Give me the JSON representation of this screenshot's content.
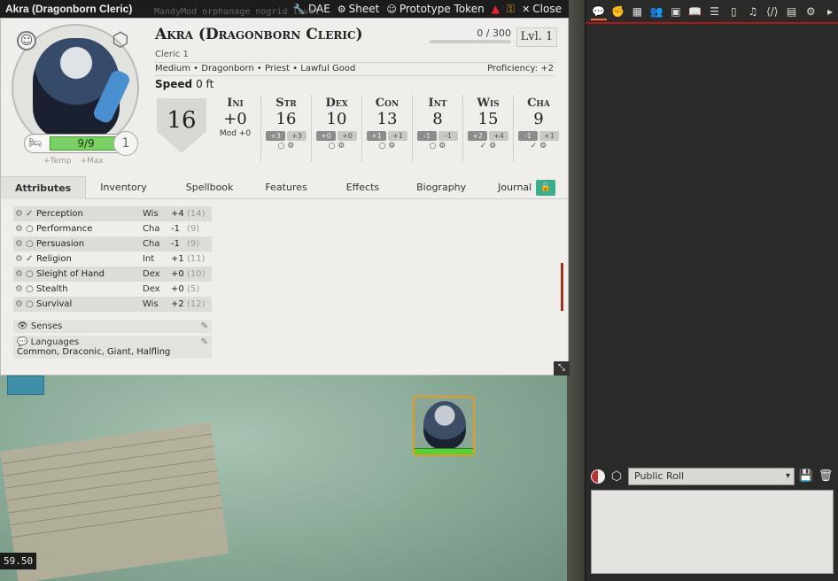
{
  "canvas": {
    "coord_readout": "59.50"
  },
  "header": {
    "title": "Akra (Dragonborn Cleric)",
    "ghost_text": "MandyMod orphanage nogrid level",
    "buttons": [
      {
        "label": "DAE",
        "icon": "wrench-icon",
        "glyph": "🔧"
      },
      {
        "label": "Sheet",
        "icon": "gear-icon",
        "glyph": "⚙"
      },
      {
        "label": "Prototype Token",
        "icon": "user-circle-icon",
        "glyph": "☺"
      },
      {
        "label": "Close",
        "icon": "close-icon",
        "glyph": "✕"
      }
    ]
  },
  "sheet": {
    "name": "Akra (Dragonborn Cleric)",
    "class": "Cleric 1",
    "details": "Medium • Dragonborn • Priest • Lawful Good",
    "proficiency": "Proficiency: +2",
    "speed_label": "Speed",
    "speed_value": "0 ft",
    "xp": "0 / 300",
    "level": "Lvl. 1",
    "hp": "9/9",
    "hp_level": "1",
    "temp_label": "+Temp",
    "max_label": "+Max",
    "ac": "16",
    "initiative": {
      "name": "Ini",
      "score": "+0",
      "mod_label": "Mod",
      "mod": "+0"
    },
    "abilities": [
      {
        "name": "Str",
        "score": "16",
        "save": "+3",
        "mod": "+3",
        "prof": false
      },
      {
        "name": "Dex",
        "score": "10",
        "save": "+0",
        "mod": "+0",
        "prof": false
      },
      {
        "name": "Con",
        "score": "13",
        "save": "+1",
        "mod": "+1",
        "prof": false
      },
      {
        "name": "Int",
        "score": "8",
        "save": "-1",
        "mod": "-1",
        "prof": false
      },
      {
        "name": "Wis",
        "score": "15",
        "save": "+2",
        "mod": "+4",
        "prof": true
      },
      {
        "name": "Cha",
        "score": "9",
        "save": "-1",
        "mod": "+1",
        "prof": true
      }
    ],
    "tabs": [
      "Attributes",
      "Inventory",
      "Spellbook",
      "Features",
      "Effects",
      "Biography",
      "Journal"
    ],
    "skills": [
      {
        "name": "Perception",
        "ability": "Wis",
        "mod": "+4",
        "passive": "(14)",
        "prof": true
      },
      {
        "name": "Performance",
        "ability": "Cha",
        "mod": "-1",
        "passive": "(9)",
        "prof": false
      },
      {
        "name": "Persuasion",
        "ability": "Cha",
        "mod": "-1",
        "passive": "(9)",
        "prof": false
      },
      {
        "name": "Religion",
        "ability": "Int",
        "mod": "+1",
        "passive": "(11)",
        "prof": true
      },
      {
        "name": "Sleight of Hand",
        "ability": "Dex",
        "mod": "+0",
        "passive": "(10)",
        "prof": false
      },
      {
        "name": "Stealth",
        "ability": "Dex",
        "mod": "+0",
        "passive": "(5)",
        "prof": false
      },
      {
        "name": "Survival",
        "ability": "Wis",
        "mod": "+2",
        "passive": "(12)",
        "prof": false
      }
    ],
    "senses_label": "Senses",
    "languages_label": "Languages",
    "languages": "Common, Draconic, Giant, Halfling"
  },
  "sidebar": {
    "tab_icons": [
      "chat-icon",
      "combat-icon",
      "scenes-icon",
      "actors-icon",
      "items-icon",
      "journal-icon",
      "tables-icon",
      "cards-icon",
      "playlists-icon",
      "macros-icon",
      "compendium-icon",
      "settings-icon",
      "collapse-icon"
    ],
    "roll_mode": "Public Roll"
  },
  "colors": {
    "accent_red": "#b01818",
    "hp_green": "#7bd064",
    "token_border": "#e39a22"
  }
}
